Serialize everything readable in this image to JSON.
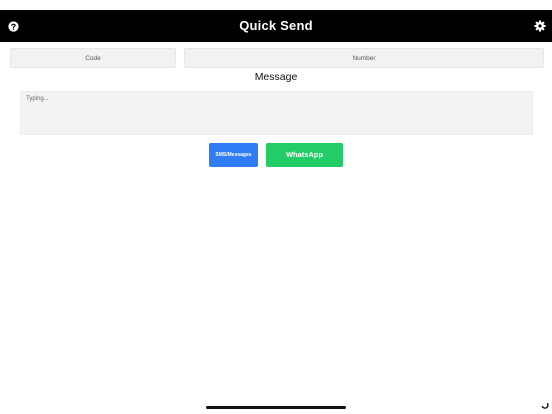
{
  "header": {
    "title": "Quick Send",
    "help_icon": "help-circle-icon",
    "settings_icon": "gear-icon"
  },
  "form": {
    "code_placeholder": "Code",
    "number_placeholder": "Number",
    "message_title": "Message",
    "message_placeholder": "Typing..."
  },
  "actions": {
    "sms_label": "SMS/Messages",
    "whatsapp_label": "WhatsApp"
  },
  "colors": {
    "header_bg": "#000000",
    "sms_button": "#2e7cf6",
    "whatsapp_button": "#22cc66"
  }
}
